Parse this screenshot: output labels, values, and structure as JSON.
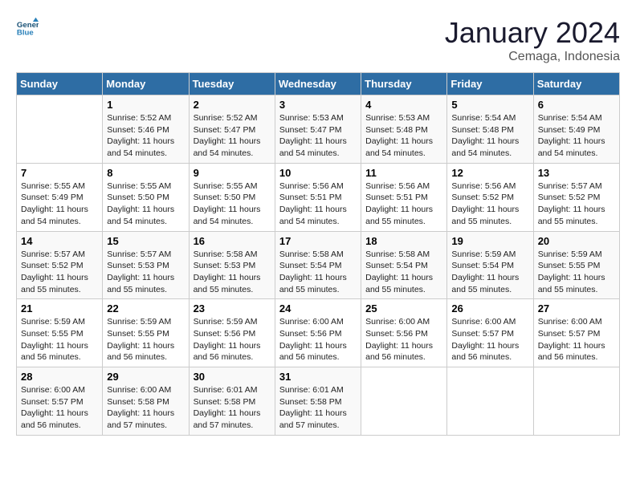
{
  "logo": {
    "line1": "General",
    "line2": "Blue"
  },
  "title": "January 2024",
  "subtitle": "Cemaga, Indonesia",
  "days_header": [
    "Sunday",
    "Monday",
    "Tuesday",
    "Wednesday",
    "Thursday",
    "Friday",
    "Saturday"
  ],
  "weeks": [
    [
      {
        "num": "",
        "info": ""
      },
      {
        "num": "1",
        "info": "Sunrise: 5:52 AM\nSunset: 5:46 PM\nDaylight: 11 hours\nand 54 minutes."
      },
      {
        "num": "2",
        "info": "Sunrise: 5:52 AM\nSunset: 5:47 PM\nDaylight: 11 hours\nand 54 minutes."
      },
      {
        "num": "3",
        "info": "Sunrise: 5:53 AM\nSunset: 5:47 PM\nDaylight: 11 hours\nand 54 minutes."
      },
      {
        "num": "4",
        "info": "Sunrise: 5:53 AM\nSunset: 5:48 PM\nDaylight: 11 hours\nand 54 minutes."
      },
      {
        "num": "5",
        "info": "Sunrise: 5:54 AM\nSunset: 5:48 PM\nDaylight: 11 hours\nand 54 minutes."
      },
      {
        "num": "6",
        "info": "Sunrise: 5:54 AM\nSunset: 5:49 PM\nDaylight: 11 hours\nand 54 minutes."
      }
    ],
    [
      {
        "num": "7",
        "info": "Sunrise: 5:55 AM\nSunset: 5:49 PM\nDaylight: 11 hours\nand 54 minutes."
      },
      {
        "num": "8",
        "info": "Sunrise: 5:55 AM\nSunset: 5:50 PM\nDaylight: 11 hours\nand 54 minutes."
      },
      {
        "num": "9",
        "info": "Sunrise: 5:55 AM\nSunset: 5:50 PM\nDaylight: 11 hours\nand 54 minutes."
      },
      {
        "num": "10",
        "info": "Sunrise: 5:56 AM\nSunset: 5:51 PM\nDaylight: 11 hours\nand 54 minutes."
      },
      {
        "num": "11",
        "info": "Sunrise: 5:56 AM\nSunset: 5:51 PM\nDaylight: 11 hours\nand 55 minutes."
      },
      {
        "num": "12",
        "info": "Sunrise: 5:56 AM\nSunset: 5:52 PM\nDaylight: 11 hours\nand 55 minutes."
      },
      {
        "num": "13",
        "info": "Sunrise: 5:57 AM\nSunset: 5:52 PM\nDaylight: 11 hours\nand 55 minutes."
      }
    ],
    [
      {
        "num": "14",
        "info": "Sunrise: 5:57 AM\nSunset: 5:52 PM\nDaylight: 11 hours\nand 55 minutes."
      },
      {
        "num": "15",
        "info": "Sunrise: 5:57 AM\nSunset: 5:53 PM\nDaylight: 11 hours\nand 55 minutes."
      },
      {
        "num": "16",
        "info": "Sunrise: 5:58 AM\nSunset: 5:53 PM\nDaylight: 11 hours\nand 55 minutes."
      },
      {
        "num": "17",
        "info": "Sunrise: 5:58 AM\nSunset: 5:54 PM\nDaylight: 11 hours\nand 55 minutes."
      },
      {
        "num": "18",
        "info": "Sunrise: 5:58 AM\nSunset: 5:54 PM\nDaylight: 11 hours\nand 55 minutes."
      },
      {
        "num": "19",
        "info": "Sunrise: 5:59 AM\nSunset: 5:54 PM\nDaylight: 11 hours\nand 55 minutes."
      },
      {
        "num": "20",
        "info": "Sunrise: 5:59 AM\nSunset: 5:55 PM\nDaylight: 11 hours\nand 55 minutes."
      }
    ],
    [
      {
        "num": "21",
        "info": "Sunrise: 5:59 AM\nSunset: 5:55 PM\nDaylight: 11 hours\nand 56 minutes."
      },
      {
        "num": "22",
        "info": "Sunrise: 5:59 AM\nSunset: 5:55 PM\nDaylight: 11 hours\nand 56 minutes."
      },
      {
        "num": "23",
        "info": "Sunrise: 5:59 AM\nSunset: 5:56 PM\nDaylight: 11 hours\nand 56 minutes."
      },
      {
        "num": "24",
        "info": "Sunrise: 6:00 AM\nSunset: 5:56 PM\nDaylight: 11 hours\nand 56 minutes."
      },
      {
        "num": "25",
        "info": "Sunrise: 6:00 AM\nSunset: 5:56 PM\nDaylight: 11 hours\nand 56 minutes."
      },
      {
        "num": "26",
        "info": "Sunrise: 6:00 AM\nSunset: 5:57 PM\nDaylight: 11 hours\nand 56 minutes."
      },
      {
        "num": "27",
        "info": "Sunrise: 6:00 AM\nSunset: 5:57 PM\nDaylight: 11 hours\nand 56 minutes."
      }
    ],
    [
      {
        "num": "28",
        "info": "Sunrise: 6:00 AM\nSunset: 5:57 PM\nDaylight: 11 hours\nand 56 minutes."
      },
      {
        "num": "29",
        "info": "Sunrise: 6:00 AM\nSunset: 5:58 PM\nDaylight: 11 hours\nand 57 minutes."
      },
      {
        "num": "30",
        "info": "Sunrise: 6:01 AM\nSunset: 5:58 PM\nDaylight: 11 hours\nand 57 minutes."
      },
      {
        "num": "31",
        "info": "Sunrise: 6:01 AM\nSunset: 5:58 PM\nDaylight: 11 hours\nand 57 minutes."
      },
      {
        "num": "",
        "info": ""
      },
      {
        "num": "",
        "info": ""
      },
      {
        "num": "",
        "info": ""
      }
    ]
  ]
}
